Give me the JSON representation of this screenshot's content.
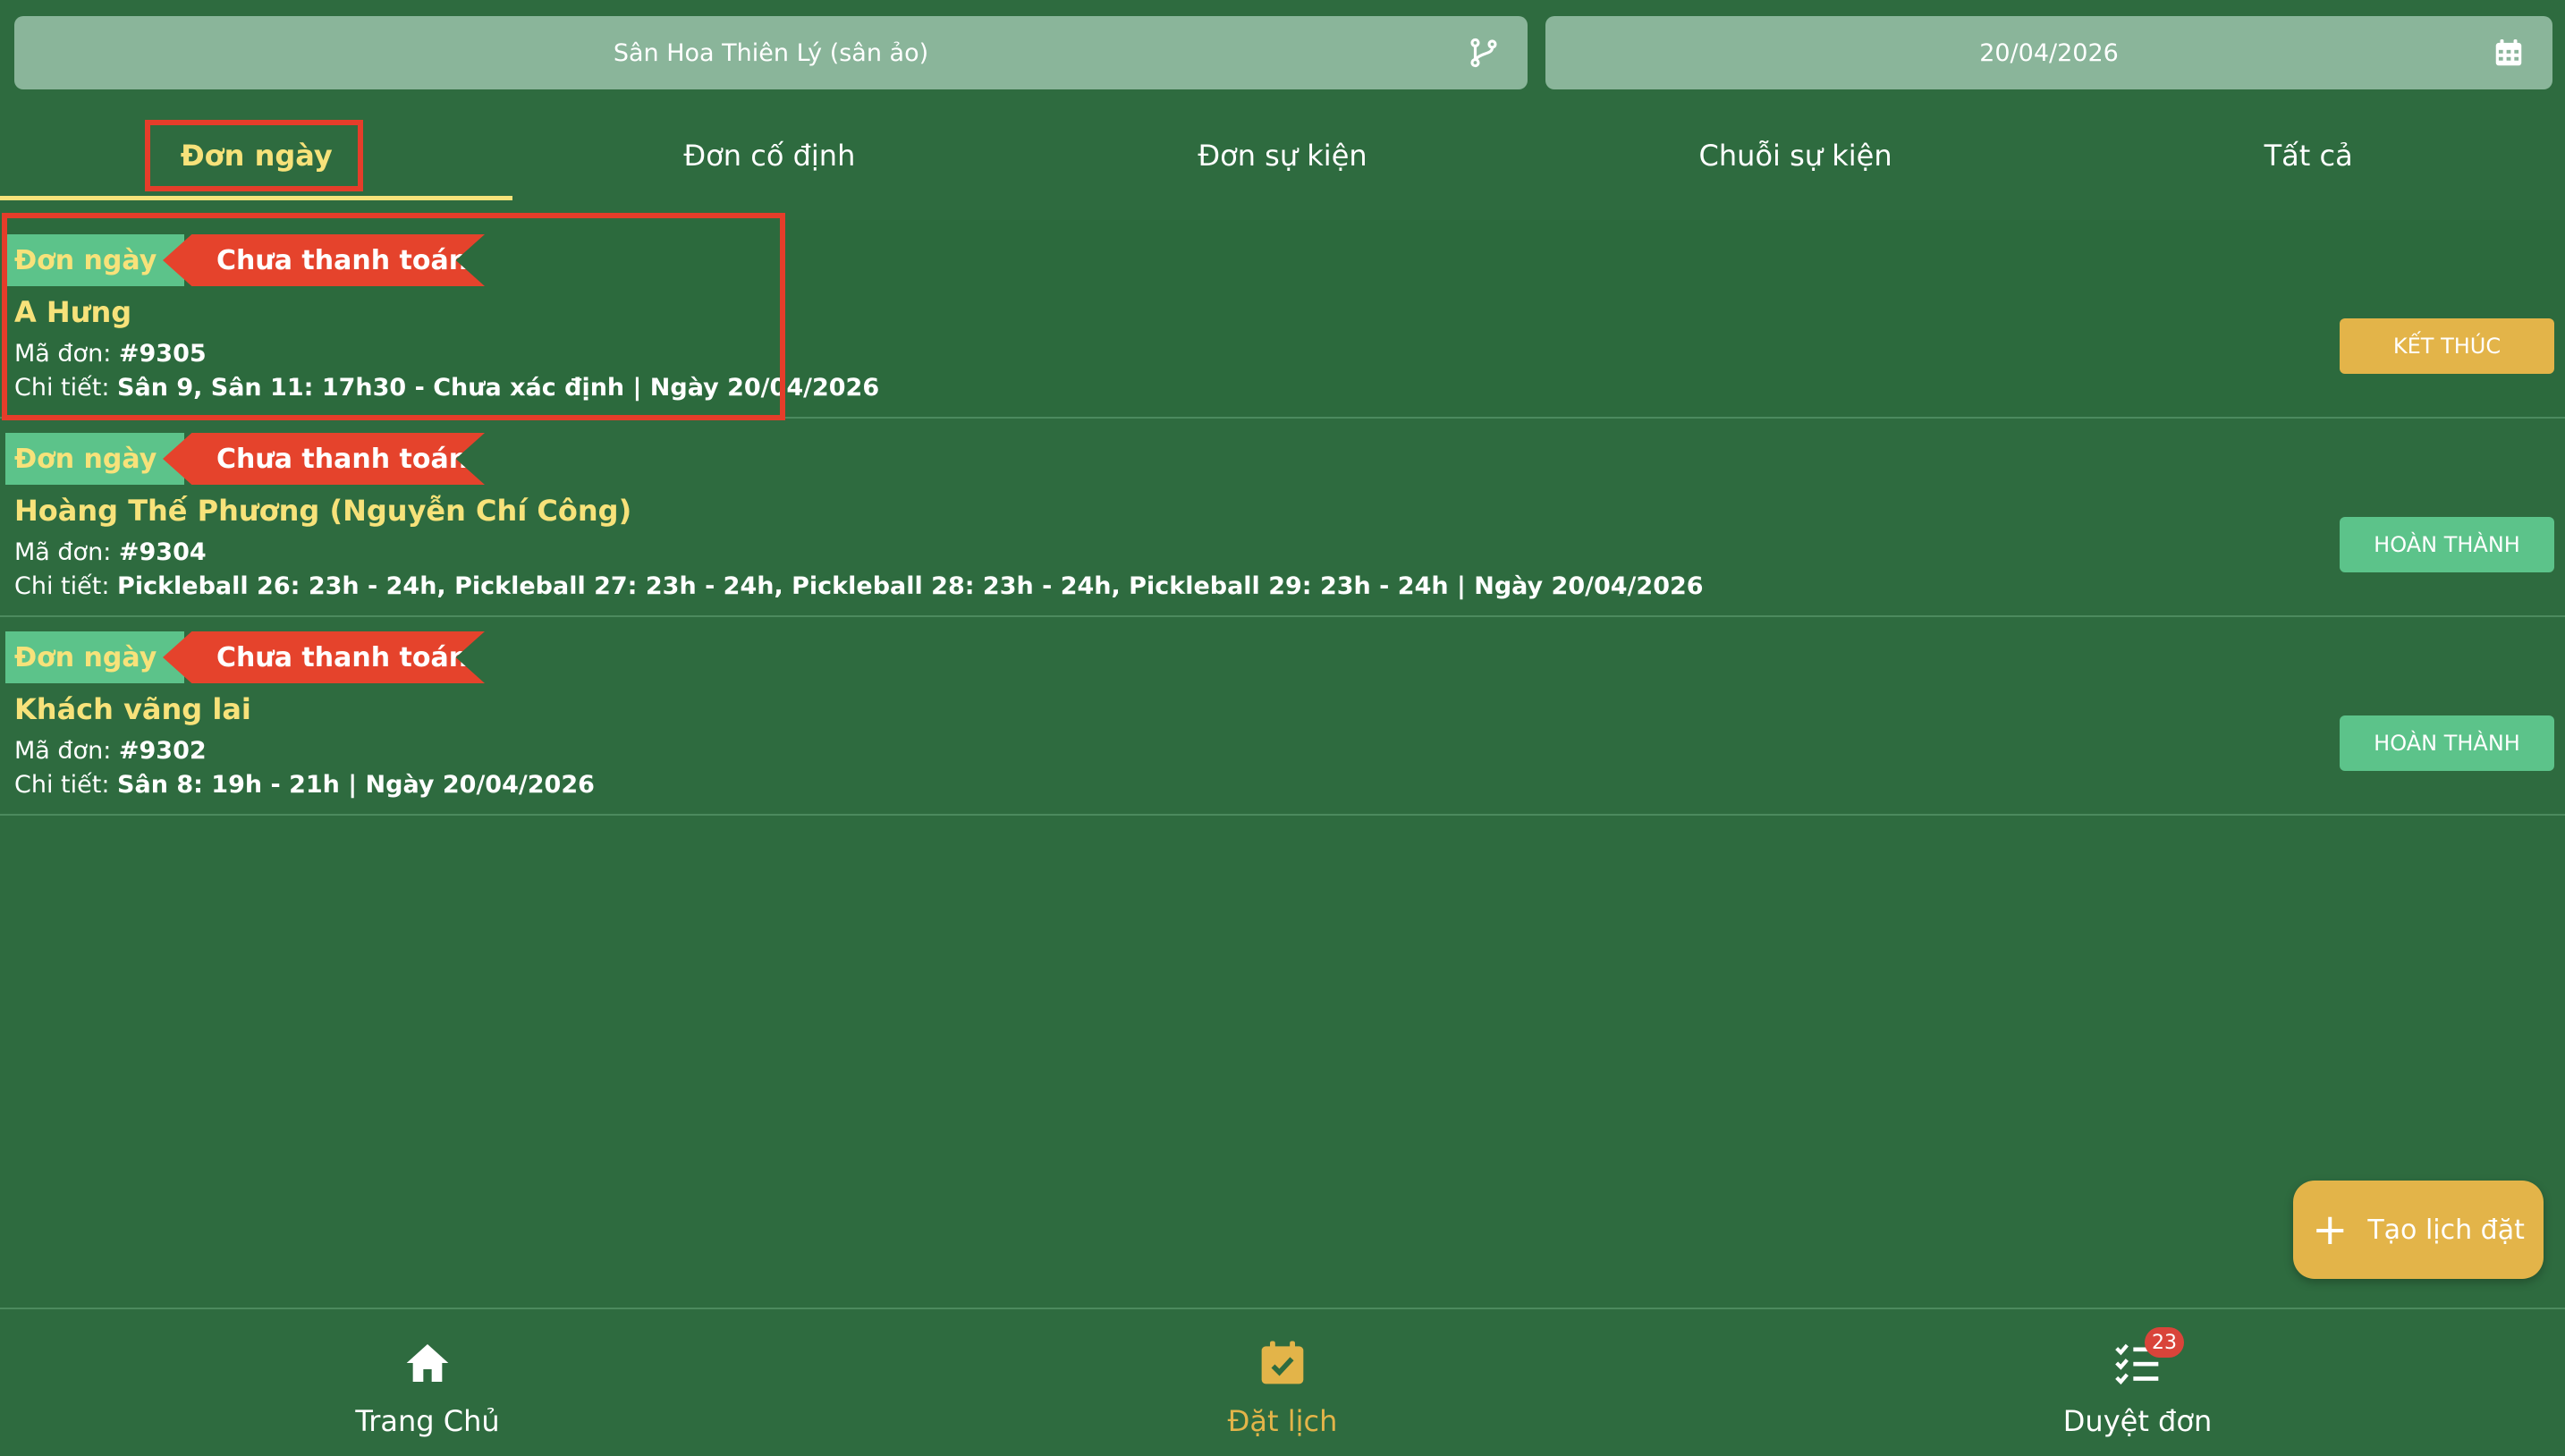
{
  "filters": {
    "court": "Sân Hoa Thiên Lý (sân ảo)",
    "date": "20/04/2026",
    "court_icon": "branch-icon",
    "date_icon": "calendar-icon"
  },
  "tabs": [
    {
      "label": "Đơn ngày",
      "active": true
    },
    {
      "label": "Đơn cố định",
      "active": false
    },
    {
      "label": "Đơn sự kiện",
      "active": false
    },
    {
      "label": "Chuỗi sự kiện",
      "active": false
    },
    {
      "label": "Tất cả",
      "active": false
    }
  ],
  "orders": [
    {
      "type_badge": "Đơn ngày",
      "payment_badge": "Chưa thanh toán",
      "customer": "A Hưng",
      "order_label": "Mã đơn:",
      "order_no": "#9305",
      "detail_label": "Chi tiết:",
      "detail": "Sân 9, Sân 11: 17h30 - Chưa xác định | Ngày 20/04/2026",
      "action": "KẾT THÚC",
      "action_color": "#e3b449"
    },
    {
      "type_badge": "Đơn ngày",
      "payment_badge": "Chưa thanh toán",
      "customer": "Hoàng Thế Phương (Nguyễn Chí Công)",
      "order_label": "Mã đơn:",
      "order_no": "#9304",
      "detail_label": "Chi tiết:",
      "detail": "Pickleball 26: 23h - 24h, Pickleball 27: 23h - 24h, Pickleball 28: 23h - 24h, Pickleball 29: 23h - 24h | Ngày 20/04/2026",
      "action": "HOÀN THÀNH",
      "action_color": "#5cc38a"
    },
    {
      "type_badge": "Đơn ngày",
      "payment_badge": "Chưa thanh toán",
      "customer": "Khách vãng lai",
      "order_label": "Mã đơn:",
      "order_no": "#9302",
      "detail_label": "Chi tiết:",
      "detail": "Sân 8: 19h - 21h | Ngày 20/04/2026",
      "action": "HOÀN THÀNH",
      "action_color": "#5cc38a"
    }
  ],
  "fab": {
    "label": "Tạo lịch đặt",
    "icon": "plus-icon"
  },
  "bottom_nav": [
    {
      "label": "Trang Chủ",
      "icon": "home-icon",
      "active": false
    },
    {
      "label": "Đặt lịch",
      "icon": "calendar-check-icon",
      "active": true
    },
    {
      "label": "Duyệt đơn",
      "icon": "checklist-icon",
      "active": false,
      "badge": "23"
    }
  ],
  "colors": {
    "background": "#2e6b3f",
    "accent_yellow": "#f7e27a",
    "badge_green": "#5cc38a",
    "badge_red": "#e5432c",
    "highlight_box": "#e53d2a"
  }
}
